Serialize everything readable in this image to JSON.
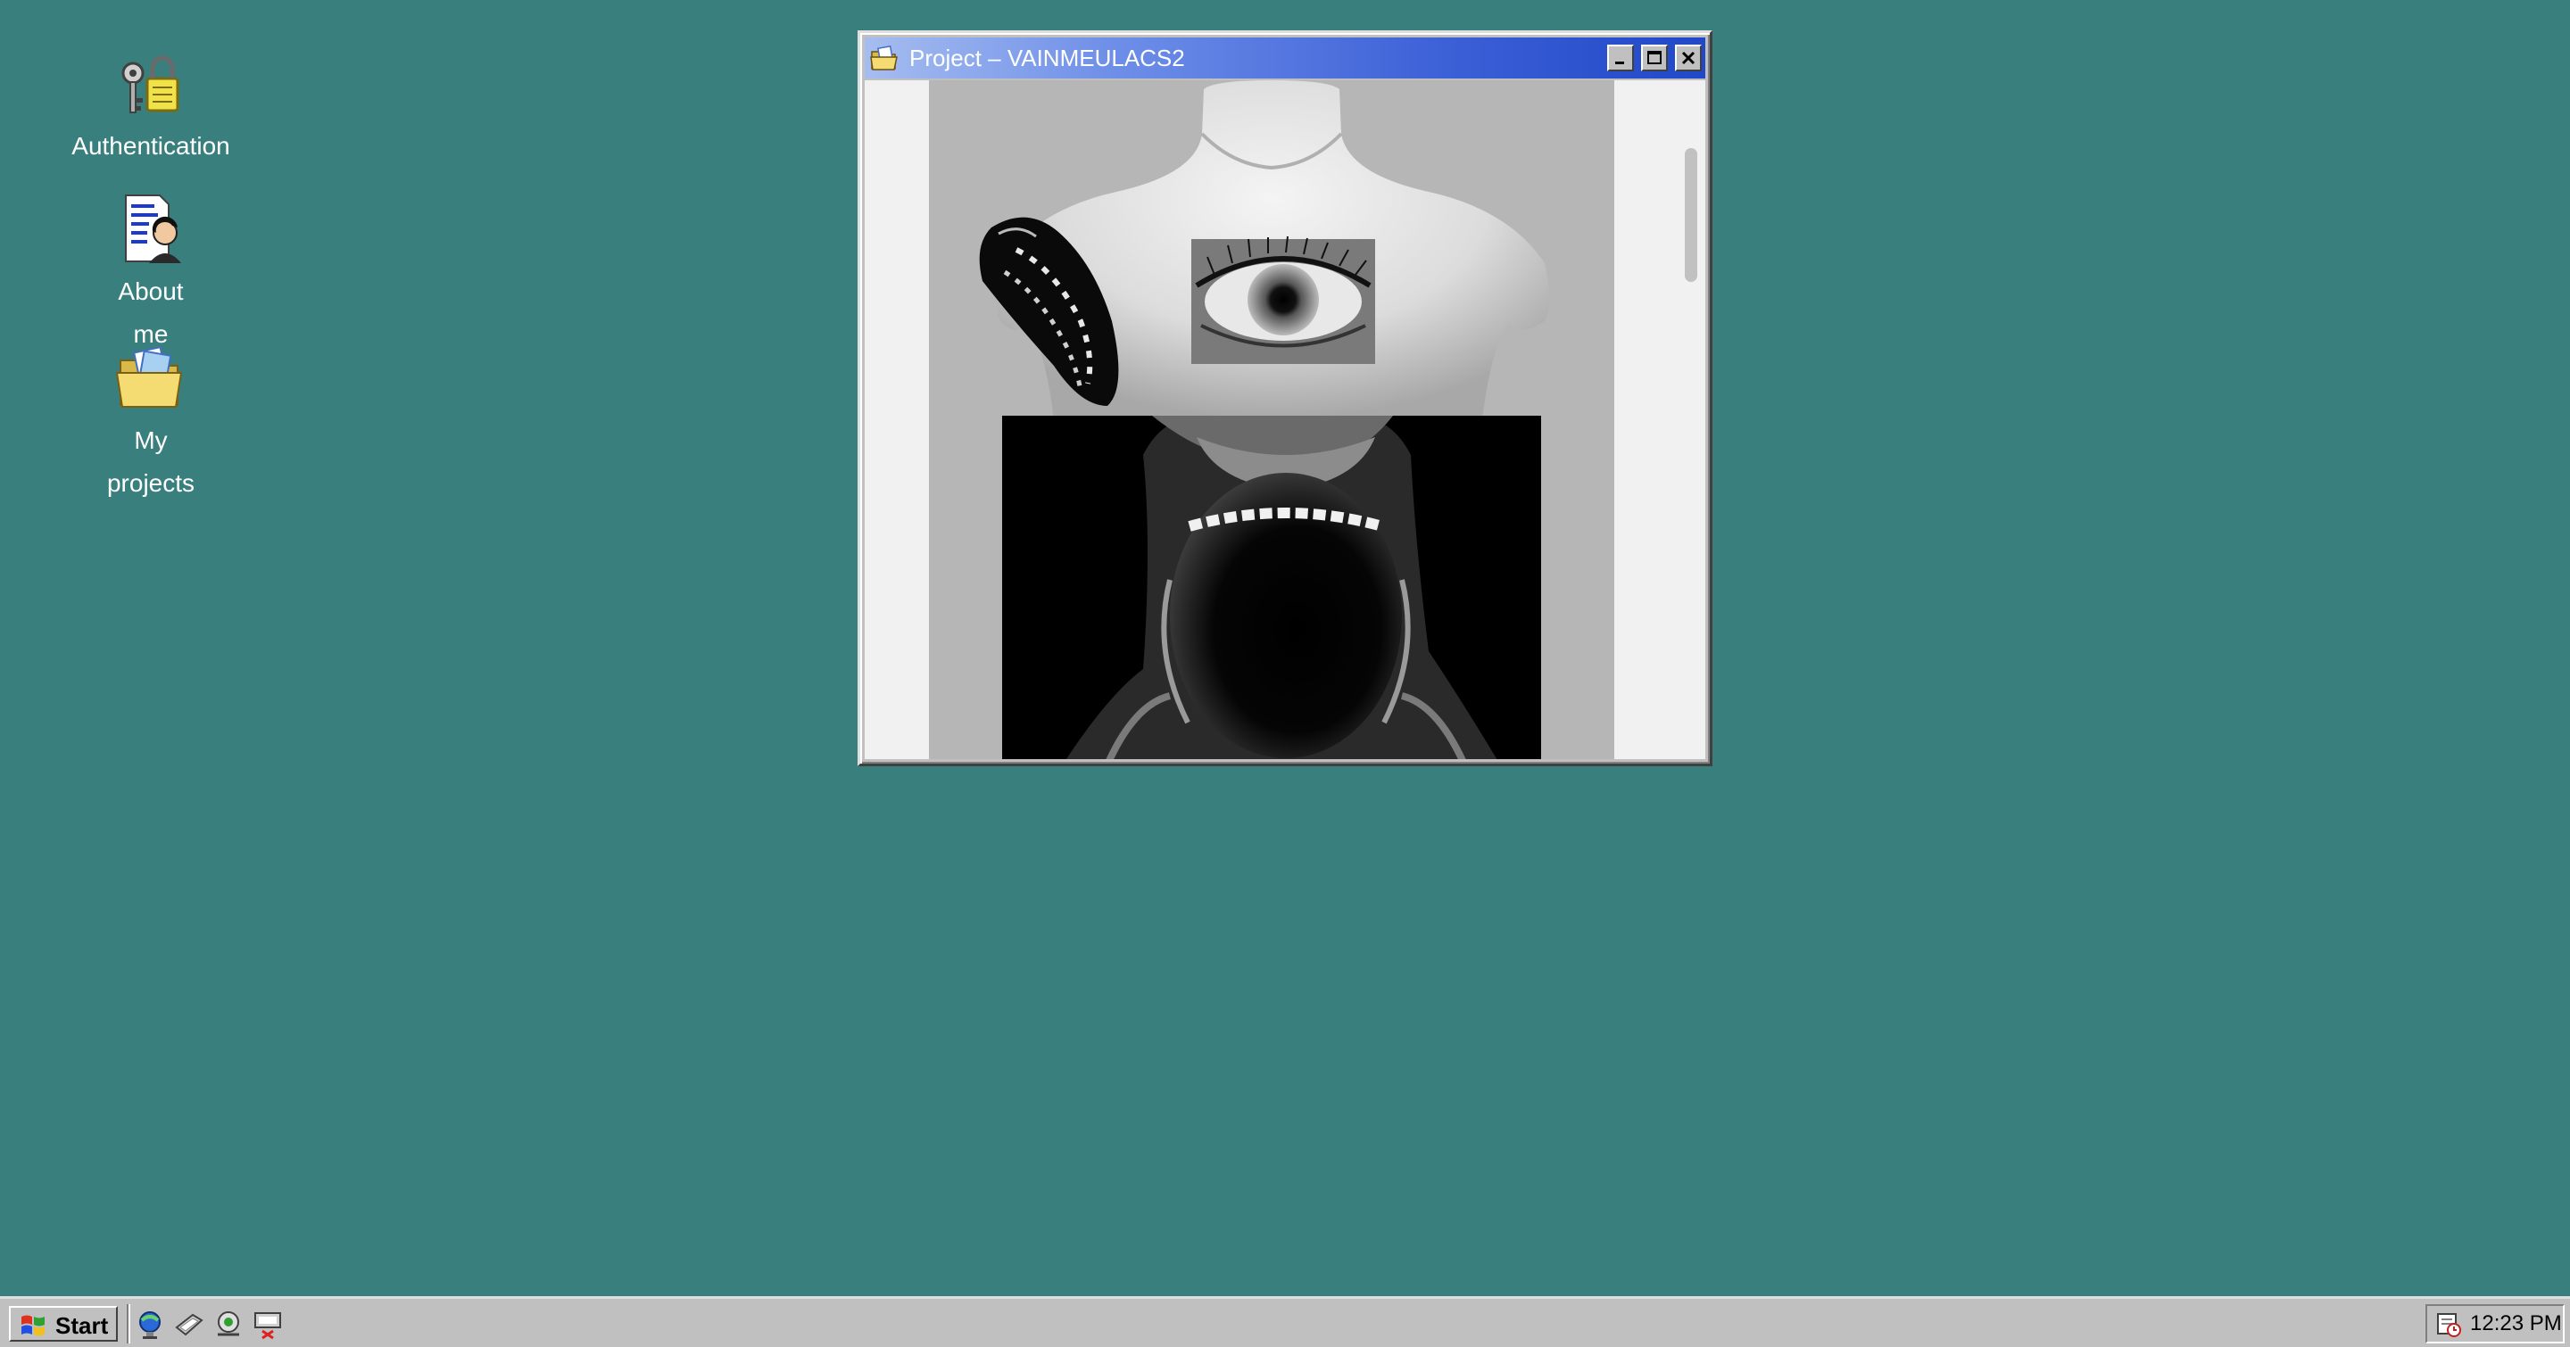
{
  "desktop": {
    "background_color": "#387f7e",
    "icons": [
      {
        "label": "Authentication",
        "icon": "keys-lock-icon"
      },
      {
        "label": "About me",
        "icon": "document-person-icon"
      },
      {
        "label": "My projects",
        "icon": "folder-icon"
      }
    ]
  },
  "window": {
    "title": "Project – VAINMEULACS2",
    "title_icon": "folder-icon",
    "controls": [
      "minimize",
      "maximize",
      "close"
    ],
    "content": "black-and-white surreal photo collage artwork"
  },
  "taskbar": {
    "start_label": "Start",
    "quick_launch": [
      "internet-explorer-icon",
      "desktop-icon",
      "channels-icon",
      "network-icon"
    ],
    "tray_icon": "scheduler-icon",
    "clock": "12:23 PM"
  },
  "colors": {
    "titlebar_start": "#a6bdf0",
    "titlebar_end": "#2048c8",
    "chrome": "#c0c0c0"
  }
}
